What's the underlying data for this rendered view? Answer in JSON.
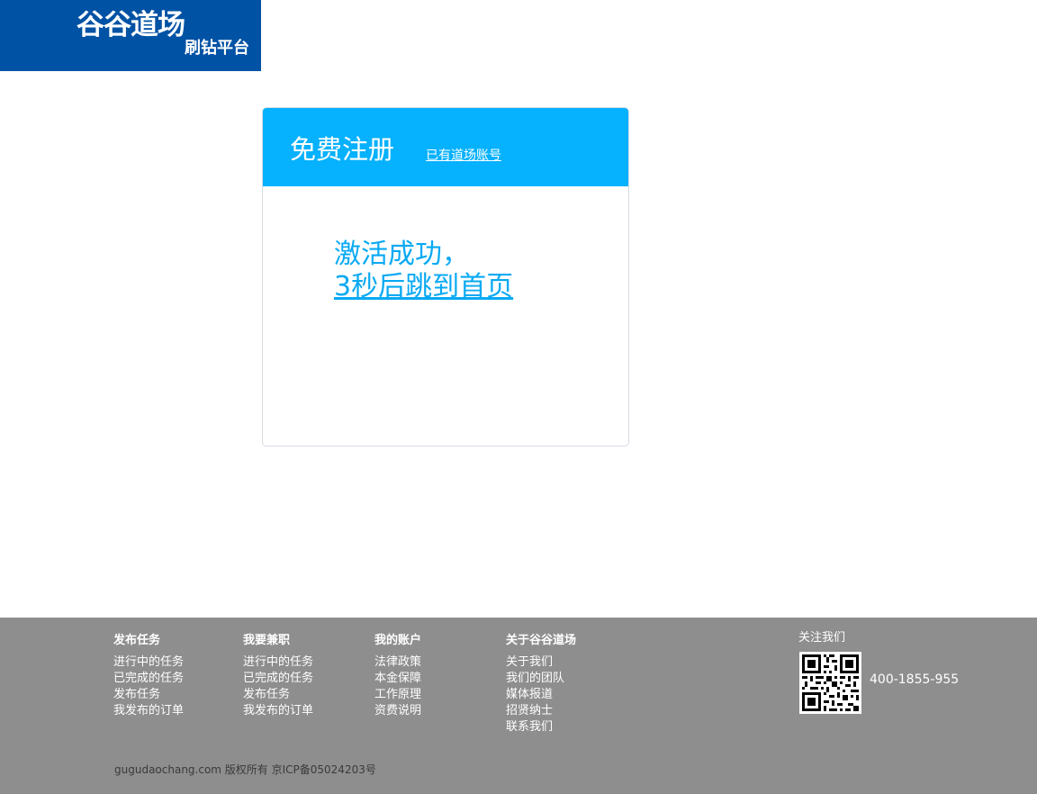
{
  "logo": {
    "brand": "谷谷道场",
    "sub": "刷钻平台"
  },
  "card": {
    "title": "免费注册",
    "login_link": "已有道场账号",
    "message_line1": "激活成功，",
    "message_line2": "3秒后跳到首页"
  },
  "footer": {
    "columns": [
      {
        "heading": "发布任务",
        "items": [
          "进行中的任务",
          "已完成的任务",
          "发布任务",
          "我发布的订单"
        ]
      },
      {
        "heading": "我要兼职",
        "items": [
          "进行中的任务",
          "已完成的任务",
          "发布任务",
          "我发布的订单"
        ]
      },
      {
        "heading": "我的账户",
        "items": [
          "法律政策",
          "本金保障",
          "工作原理",
          "资费说明"
        ]
      },
      {
        "heading": "关于谷谷道场",
        "items": [
          "关于我们",
          "我们的团队",
          "媒体报道",
          "招贤纳士",
          "联系我们"
        ]
      }
    ],
    "follow_label": "关注我们",
    "phone": "400-1855-955",
    "copyright": "gugudaochang.com 版权所有 京ICP备05024203号"
  },
  "colors": {
    "logo_bg": "#0052a4",
    "header_bg": "#06b1fd",
    "message_text": "#08a9f3",
    "footer_bg": "#8e8e8e"
  },
  "icons": {
    "qr": "qr-code-icon"
  }
}
